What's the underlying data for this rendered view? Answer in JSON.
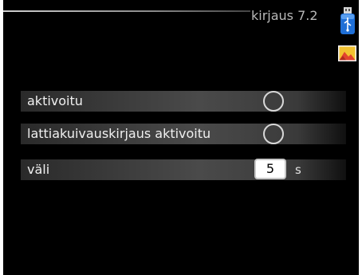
{
  "header": {
    "title": "kirjaus 7.2"
  },
  "icons": {
    "usb": "usb-icon",
    "picture": "picture-icon"
  },
  "settings": {
    "rows": [
      {
        "label": "aktivoitu",
        "control": "radio",
        "selected": false
      },
      {
        "label": "lattiakuivauskirjaus aktivoitu",
        "control": "radio",
        "selected": false
      },
      {
        "label": "väli",
        "control": "value",
        "value": "5",
        "unit": "s"
      }
    ]
  },
  "colors": {
    "background": "#000000",
    "text": "#f0f0f0",
    "usb_blue": "#1f6fd6",
    "picture_red": "#e2432e",
    "picture_yellow": "#f2c230"
  }
}
